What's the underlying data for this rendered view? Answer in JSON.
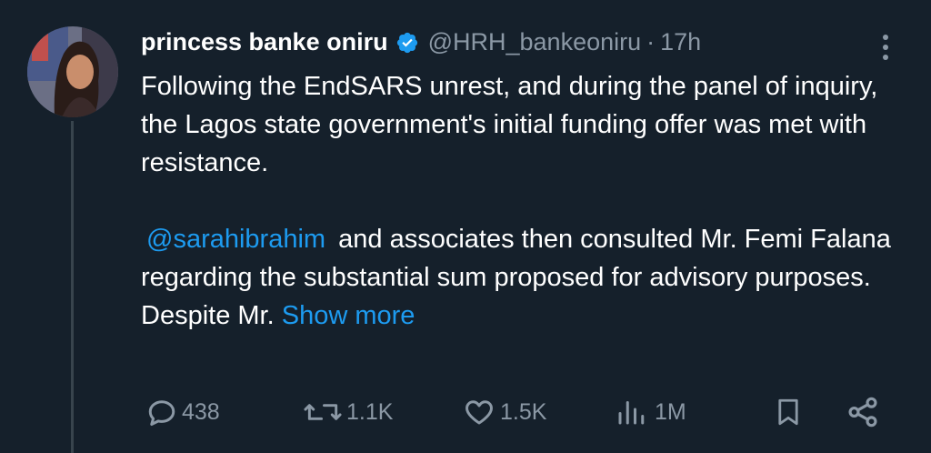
{
  "tweet": {
    "author_name": "princess banke oniru",
    "handle": "@HRH_bankeoniru",
    "separator": "·",
    "time": "17h",
    "text_p1": "Following the EndSARS unrest, and during the panel of inquiry, the Lagos state government's initial funding offer was met with resistance.",
    "mention": "@sarahibrahim",
    "text_p2_rest": "and associates then consulted Mr. Femi Falana regarding the substantial sum proposed for advisory purposes.",
    "text_p3_start": "Despite Mr.",
    "show_more": "Show more"
  },
  "actions": {
    "replies": "438",
    "retweets": "1.1K",
    "likes": "1.5K",
    "views": "1M"
  },
  "colors": {
    "background": "#15202b",
    "secondary_text": "#8b98a5",
    "link": "#1d9bf0",
    "verified_badge": "#1d9bf0"
  },
  "icons": [
    "verified-badge-icon",
    "more-options-icon",
    "reply-icon",
    "retweet-icon",
    "like-icon",
    "views-icon",
    "bookmark-icon",
    "share-icon"
  ]
}
